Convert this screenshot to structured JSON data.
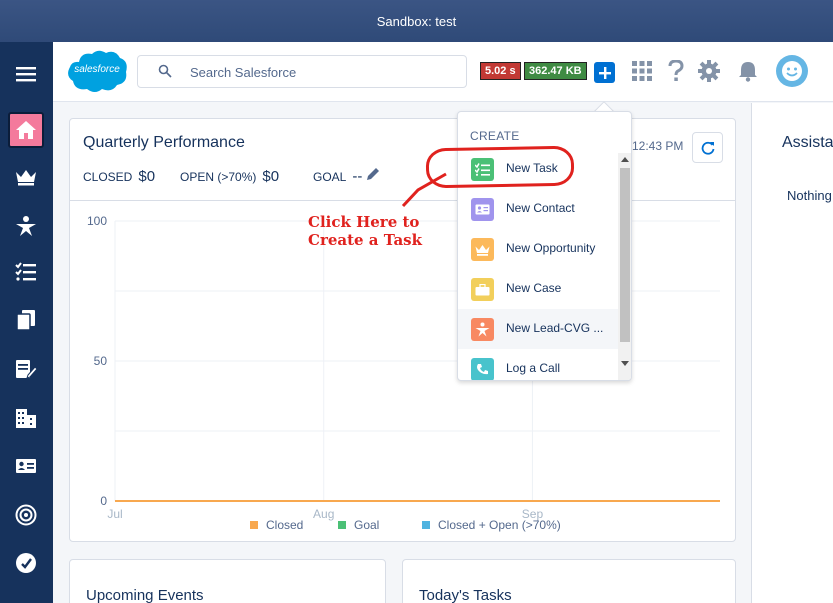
{
  "sandbox": {
    "label": "Sandbox: test"
  },
  "header": {
    "logo_text": "salesforce",
    "search_placeholder": "Search Salesforce",
    "timing_badge": "5.02 s",
    "memory_badge": "362.47 KB"
  },
  "left_nav": {
    "items": [
      "menu-icon",
      "home-icon",
      "crown-icon",
      "person-star-icon",
      "task-list-icon",
      "documents-icon",
      "notes-edit-icon",
      "building-icon",
      "contact-card-icon",
      "target-icon",
      "speedometer-icon"
    ]
  },
  "performance": {
    "title": "Quarterly Performance",
    "closed_label": "CLOSED",
    "closed_value": "$0",
    "open_label": "OPEN (>70%)",
    "open_value": "$0",
    "goal_label": "GOAL",
    "goal_value": "--",
    "updated_time": "12:43 PM"
  },
  "annotation": {
    "line1": "Click Here to",
    "line2": "Create a Task"
  },
  "dropdown": {
    "heading": "CREATE",
    "items": [
      {
        "label": "New Task",
        "color": "#4bc076"
      },
      {
        "label": "New Contact",
        "color": "#a094ed"
      },
      {
        "label": "New Opportunity",
        "color": "#fcb95b"
      },
      {
        "label": "New Case",
        "color": "#f2cf5b"
      },
      {
        "label": "New Lead-CVG ...",
        "color": "#f88962"
      },
      {
        "label": "Log a Call",
        "color": "#48c3cc"
      }
    ]
  },
  "assistant": {
    "title": "Assistant",
    "empty_text": "Nothing"
  },
  "bottom": {
    "events_title": "Upcoming Events",
    "tasks_title": "Today's Tasks"
  },
  "chart_data": {
    "type": "line",
    "x": [
      "Jul",
      "Aug",
      "Sep"
    ],
    "ylim": [
      0,
      100
    ],
    "yticks": [
      0,
      50,
      100
    ],
    "series": [
      {
        "name": "Closed",
        "values": [
          0,
          0,
          0
        ],
        "color": "#f8a84f"
      },
      {
        "name": "Goal",
        "values": [],
        "color": "#4bc076"
      },
      {
        "name": "Closed + Open (>70%)",
        "values": [],
        "color": "#4fb3e0"
      }
    ],
    "legend": "bottom",
    "grid": true
  }
}
